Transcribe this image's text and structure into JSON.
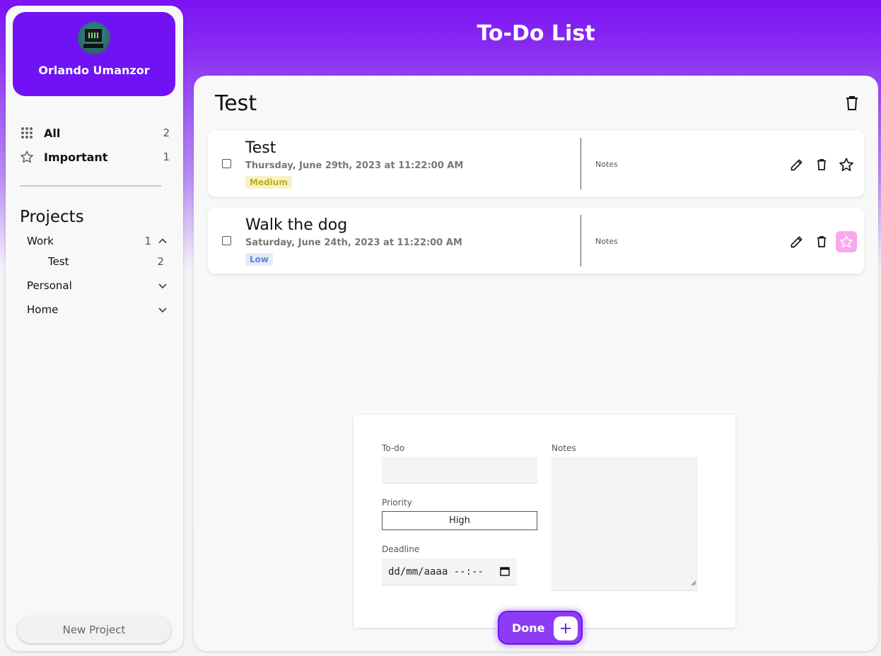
{
  "app": {
    "title": "To-Do List"
  },
  "profile": {
    "name": "Orlando Umanzor"
  },
  "nav": {
    "all": {
      "label": "All",
      "count": "2"
    },
    "important": {
      "label": "Important",
      "count": "1"
    }
  },
  "projects": {
    "title": "Projects",
    "work": {
      "label": "Work",
      "count": "1"
    },
    "test": {
      "label": "Test",
      "count": "2"
    },
    "personal": {
      "label": "Personal"
    },
    "home": {
      "label": "Home"
    },
    "new_project_label": "New Project"
  },
  "main": {
    "heading": "Test"
  },
  "tasks": [
    {
      "title": "Test",
      "date": "Thursday, June 29th, 2023 at 11:22:00 AM",
      "priority": "Medium",
      "notes": "Notes",
      "important": false
    },
    {
      "title": "Walk the dog",
      "date": "Saturday, June 24th, 2023 at 11:22:00 AM",
      "priority": "Low",
      "notes": "Notes",
      "important": true
    }
  ],
  "form": {
    "todo_label": "To-do",
    "todo_value": "",
    "priority_label": "Priority",
    "priority_value": "High",
    "deadline_label": "Deadline",
    "deadline_placeholder": "dd/mm/aaaa --:--",
    "notes_label": "Notes",
    "submit_label": "Done"
  },
  "colors": {
    "accent": "#7012f4",
    "star_highlight": "#f9a8f0",
    "medium": "#c2ad16",
    "low": "#5b83e0"
  }
}
